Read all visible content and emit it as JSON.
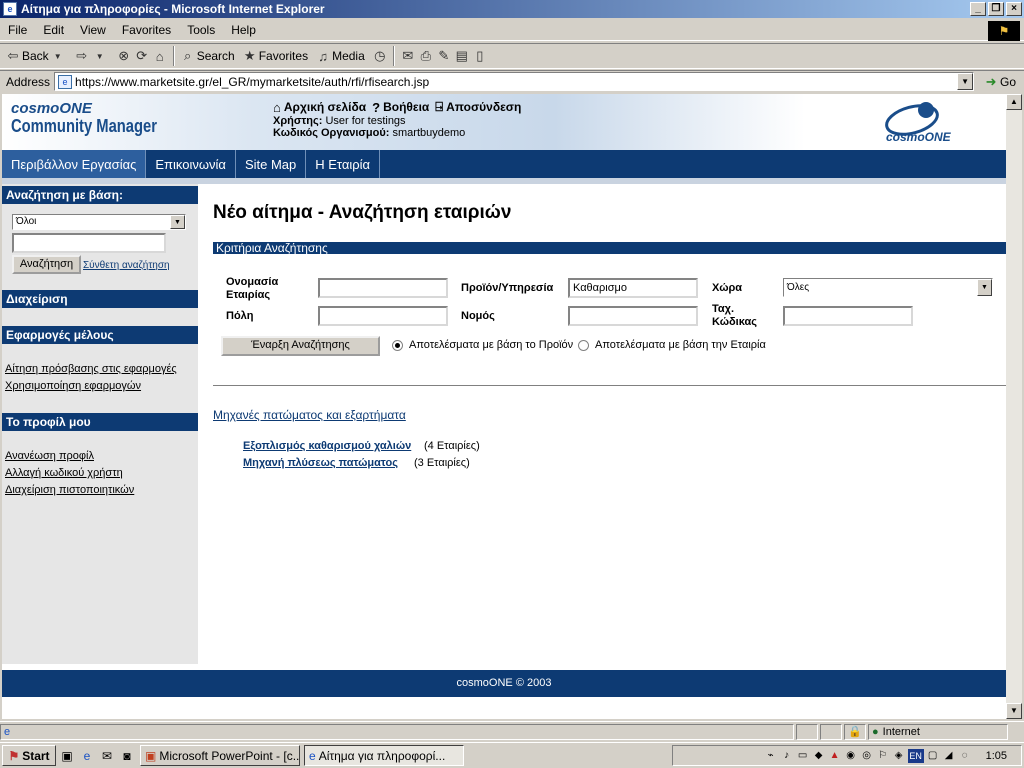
{
  "window": {
    "title": "Αίτημα για πληροφορίες - Microsoft Internet Explorer",
    "buttons": [
      "_",
      "❐",
      "×"
    ]
  },
  "menu": [
    "File",
    "Edit",
    "View",
    "Favorites",
    "Tools",
    "Help"
  ],
  "toolbar": {
    "back": "Back",
    "search": "Search",
    "favorites": "Favorites",
    "media": "Media"
  },
  "address": {
    "label": "Address",
    "url": "https://www.marketsite.gr/el_GR/mymarketsite/auth/rfi/rfisearch.jsp",
    "go": "Go"
  },
  "header": {
    "brand_small": "cosmoONE",
    "brand_large": "Community Manager",
    "links": [
      "Αρχική σελίδα",
      "Βοήθεια",
      "Αποσύνδεση"
    ],
    "user_label": "Χρήστης:",
    "user_value": "User for testings",
    "org_label": "Κωδικός Οργανισμού:",
    "org_value": "smartbuydemo",
    "logo_text": "cosmoONE"
  },
  "nav": [
    "Περιβάλλον Εργασίας",
    "Επικοινωνία",
    "Site Map",
    "Η Εταιρία"
  ],
  "sidebar": {
    "search_head": "Αναζήτηση με βάση:",
    "select_value": "Όλοι",
    "search_button": "Αναζήτηση",
    "advanced_link": "Σύνθετη αναζήτηση",
    "admin_head": "Διαχείριση",
    "apps_head": "Εφαρμογές μέλους",
    "apps_links": [
      "Αίτηση πρόσβασης στις εφαρμογές",
      "Χρησιμοποίηση εφαρμογών"
    ],
    "profile_head": "Το προφίλ μου",
    "profile_links": [
      "Ανανέωση προφίλ",
      "Αλλαγή κωδικού χρήστη",
      "Διαχείριση πιστοποιητικών"
    ]
  },
  "main": {
    "title": "Νέο αίτημα - Αναζήτηση εταιριών",
    "criteria": "Κριτήρια Αναζήτησης",
    "fields": {
      "company_label": "Ονομασία Εταιρίας",
      "company_value": "",
      "product_label": "Προϊόν/Υπηρεσία",
      "product_value": "Καθαρισμο",
      "country_label": "Χώρα",
      "country_value": "Όλες",
      "city_label": "Πόλη",
      "city_value": "",
      "prefecture_label": "Νομός",
      "prefecture_value": "",
      "postal_label": "Ταχ. Κώδικας",
      "postal_value": ""
    },
    "start_button": "Έναρξη Αναζήτησης",
    "radio_product": "Αποτελέσματα με βάση το Προϊόν",
    "radio_company": "Αποτελέσματα με βάση την Εταιρία",
    "radio_selected": "product",
    "category": "Μηχανές πατώματος και εξαρτήματα",
    "results": [
      {
        "name": "Εξοπλισμός καθαρισμού χαλιών",
        "count": "(4 Εταιρίες)"
      },
      {
        "name": "Μηχανή πλύσεως πατώματος",
        "count": "(3 Εταιρίες)"
      }
    ]
  },
  "footer": "cosmoONE © 2003",
  "status": {
    "zone": "Internet"
  },
  "taskbar": {
    "start": "Start",
    "tasks": [
      "Microsoft PowerPoint - [c...",
      "Αίτημα για πληροφορί..."
    ],
    "tray_lang": "EN",
    "clock": "1:05"
  }
}
